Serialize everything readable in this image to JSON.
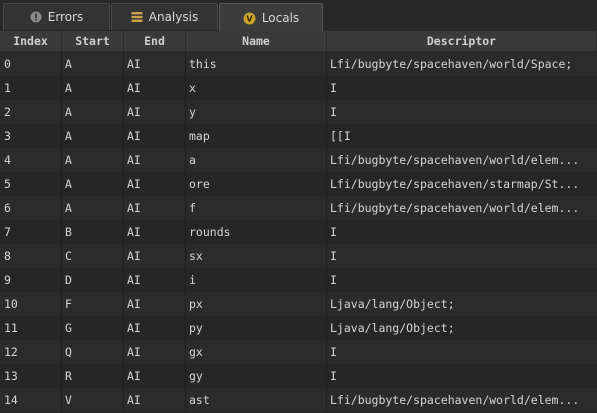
{
  "tabs": [
    {
      "label": "Errors",
      "icon": "error-icon",
      "active": false
    },
    {
      "label": "Analysis",
      "icon": "list-icon",
      "active": false
    },
    {
      "label": "Locals",
      "icon": "variable-icon",
      "active": true
    }
  ],
  "table": {
    "columns": [
      "Index",
      "Start",
      "End",
      "Name",
      "Descriptor"
    ],
    "rows": [
      [
        "0",
        "A",
        "AI",
        "this",
        "Lfi/bugbyte/spacehaven/world/Space;"
      ],
      [
        "1",
        "A",
        "AI",
        "x",
        "I"
      ],
      [
        "2",
        "A",
        "AI",
        "y",
        "I"
      ],
      [
        "3",
        "A",
        "AI",
        "map",
        "[[I"
      ],
      [
        "4",
        "A",
        "AI",
        "a",
        "Lfi/bugbyte/spacehaven/world/elem..."
      ],
      [
        "5",
        "A",
        "AI",
        "ore",
        "Lfi/bugbyte/spacehaven/starmap/St..."
      ],
      [
        "6",
        "A",
        "AI",
        "f",
        "Lfi/bugbyte/spacehaven/world/elem..."
      ],
      [
        "7",
        "B",
        "AI",
        "rounds",
        "I"
      ],
      [
        "8",
        "C",
        "AI",
        "sx",
        "I"
      ],
      [
        "9",
        "D",
        "AI",
        "i",
        "I"
      ],
      [
        "10",
        "F",
        "AI",
        "px",
        "Ljava/lang/Object;"
      ],
      [
        "11",
        "G",
        "AI",
        "py",
        "Ljava/lang/Object;"
      ],
      [
        "12",
        "Q",
        "AI",
        "gx",
        "I"
      ],
      [
        "13",
        "R",
        "AI",
        "gy",
        "I"
      ],
      [
        "14",
        "V",
        "AI",
        "ast",
        "Lfi/bugbyte/spacehaven/world/elem..."
      ]
    ]
  },
  "colors": {
    "background": "#252525",
    "header_bg": "#3a3a3a",
    "row_odd": "#2b2b2b",
    "row_even": "#262626",
    "text": "#d6d6d6",
    "locals_icon": "#c9a227",
    "error_icon": "#8a8a8a",
    "list_icon": "#c9a24a"
  }
}
